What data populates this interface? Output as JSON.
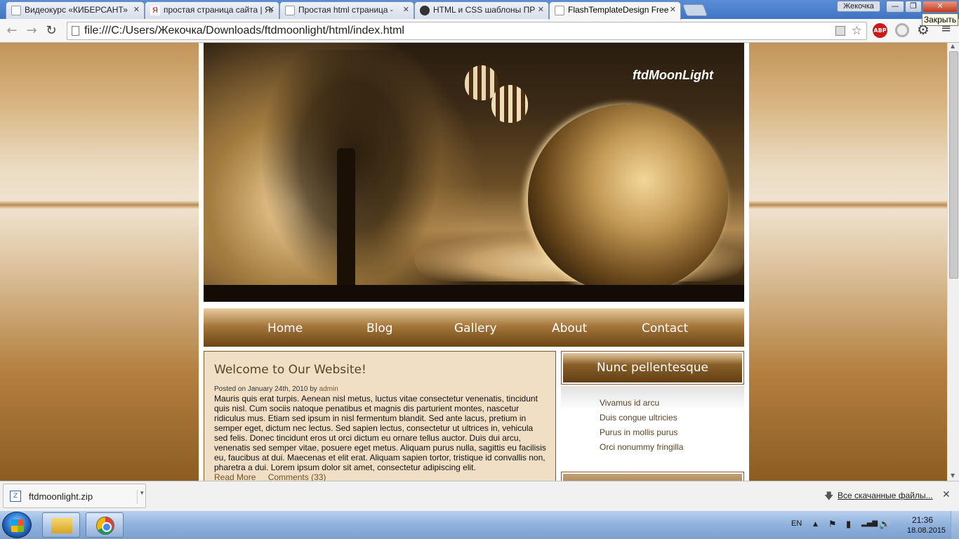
{
  "browser": {
    "tabs": [
      {
        "label": "Видеокурс «КИБЕРСАНТ»",
        "favicon": "document-icon",
        "color": "#ffffff"
      },
      {
        "label": "простая страница сайта | Яндекс",
        "favicon": "yandex-icon",
        "color": "#e8e8e8"
      },
      {
        "label": "Простая html страница - ",
        "favicon": "document-icon",
        "color": "#ffffff"
      },
      {
        "label": "HTML и CSS шаблоны ПР",
        "favicon": "github-icon",
        "color": "#333333"
      },
      {
        "label": "FlashTemplateDesign Free",
        "favicon": "document-icon",
        "color": "#ffffff",
        "active": true
      }
    ],
    "close_glyph": "✕",
    "user_badge": "Жекочка",
    "window_buttons": {
      "minimize": "—",
      "maximize": "❐",
      "close": "✕"
    },
    "tooltip": "Закрыть",
    "toolbar": {
      "back_glyph": "←",
      "forward_glyph": "→",
      "reload_glyph": "↻",
      "url": "file:///C:/Users/Жекочка/Downloads/ftdmoonlight/html/index.html",
      "star_glyph": "☆",
      "abp_label": "ABP",
      "gear_glyph": "⚙",
      "menu_glyph": "≡"
    }
  },
  "page": {
    "site_title": "ftdMoonLight",
    "nav": [
      "Home",
      "Blog",
      "Gallery",
      "About",
      "Contact"
    ],
    "post": {
      "title": "Welcome to Our Website!",
      "meta_prefix": "Posted on January 24th, 2010 by ",
      "meta_author": "admin",
      "body": "Mauris quis erat turpis. Aenean nisl metus, luctus vitae consectetur venenatis, tincidunt quis nisl. Cum sociis natoque penatibus et magnis dis parturient montes, nascetur ridiculus mus. Etiam sed ipsum in nisl fermentum blandit. Sed ante lacus, pretium in semper eget, dictum nec lectus. Sed sapien lectus, consectetur ut ultrices in, vehicula sed felis. Donec tincidunt eros ut orci dictum eu ornare tellus auctor. Duis dui arcu, venenatis sed semper vitae, posuere eget metus. Aliquam purus nulla, sagittis eu facilisis eu, faucibus at dui. Maecenas et elit erat. Aliquam sapien tortor, tristique id convallis non, pharetra a dui. Lorem ipsum dolor sit amet, consectetur adipiscing elit.",
      "read_more": "Read More",
      "comments": "Comments (33)"
    },
    "sidebar": {
      "title": "Nunc pellentesque",
      "items": [
        "Vivamus id arcu",
        "Duis congue ultricies",
        "Purus in mollis purus",
        "Orci nonummy fringilla"
      ]
    }
  },
  "downloads": {
    "file_name": "ftdmoonlight.zip",
    "show_all": "Все скачанные файлы...",
    "close_glyph": "✕",
    "caret_glyph": "▾",
    "arrow_glyph": "🡇"
  },
  "taskbar": {
    "language": "EN",
    "time": "21:36",
    "date": "18.08.2015",
    "tray_glyphs": [
      "▲",
      "⚑",
      "▮",
      "▂▄▆",
      "🔊"
    ]
  },
  "colors": {
    "accent_brown": "#7b5a2e",
    "content_bg": "#f0dfc4",
    "close_red": "#c43a1c"
  }
}
